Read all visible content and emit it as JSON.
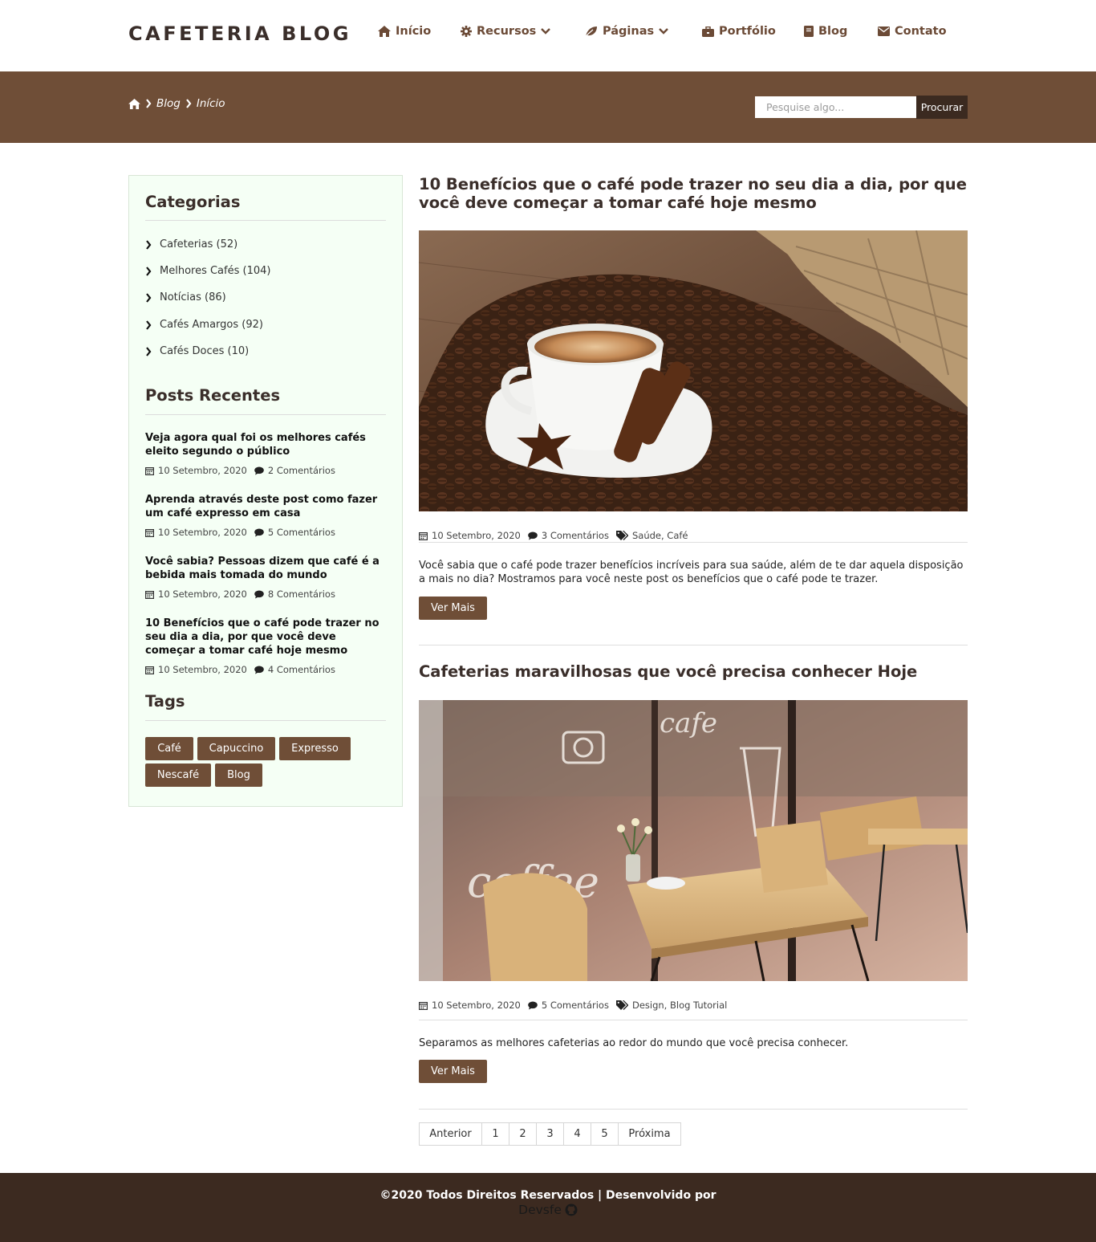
{
  "colors": {
    "brand_brown": "#6f4e37",
    "dark_brown": "#3c2a20",
    "sidebar_bg": "#f5fff5"
  },
  "header": {
    "brand": "CAFETERIA BLOG",
    "nav": [
      {
        "label": "Início",
        "icon": "home-icon"
      },
      {
        "label": "Recursos",
        "icon": "gear-icon",
        "dropdown": true
      },
      {
        "label": "Páginas",
        "icon": "leaf-icon",
        "dropdown": true
      },
      {
        "label": "Portfólio",
        "icon": "briefcase-icon"
      },
      {
        "label": "Blog",
        "icon": "book-icon"
      },
      {
        "label": "Contato",
        "icon": "envelope-icon"
      }
    ]
  },
  "banner": {
    "breadcrumb": [
      "Blog",
      "Início"
    ],
    "search_placeholder": "Pesquise algo...",
    "search_button": "Procurar"
  },
  "sidebar": {
    "categories_title": "Categorias",
    "categories": [
      "Cafeterias (52)",
      "Melhores Cafés (104)",
      "Notícias (86)",
      "Cafés Amargos (92)",
      "Cafés Doces (10)"
    ],
    "recent_title": "Posts Recentes",
    "recent": [
      {
        "title": "Veja agora qual foi os melhores cafés eleito segundo o público",
        "date": "10 Setembro, 2020",
        "comments": "2 Comentários"
      },
      {
        "title": "Aprenda através deste post como fazer um café expresso em casa",
        "date": "10 Setembro, 2020",
        "comments": "5 Comentários"
      },
      {
        "title": "Você sabia? Pessoas dizem que café é a bebida mais tomada do mundo",
        "date": "10 Setembro, 2020",
        "comments": "8 Comentários"
      },
      {
        "title": "10 Benefícios que o café pode trazer no seu dia a dia, por que você deve começar a tomar café hoje mesmo",
        "date": "10 Setembro, 2020",
        "comments": "4 Comentários"
      }
    ],
    "tags_title": "Tags",
    "tags": [
      "Café",
      "Capuccino",
      "Expresso",
      "Nescafé",
      "Blog"
    ]
  },
  "posts": [
    {
      "title": "10 Benefícios que o café pode trazer no seu dia a dia, por que você deve começar a tomar café hoje mesmo",
      "date": "10 Setembro, 2020",
      "comments": "3 Comentários",
      "tags": "Saúde, Café",
      "excerpt": "Você sabia que o café pode trazer benefícios incríveis para sua saúde, além de te dar aquela disposição a mais no dia? Mostramos para você neste post os benefícios que o café pode te trazer.",
      "button": "Ver Mais"
    },
    {
      "title": "Cafeterias maravilhosas que você precisa conhecer Hoje",
      "date": "10 Setembro, 2020",
      "comments": "5 Comentários",
      "tags": "Design, Blog Tutorial",
      "excerpt": "Separamos as melhores cafeterias ao redor do mundo que você precisa conhecer.",
      "button": "Ver Mais"
    }
  ],
  "pagination": [
    "Anterior",
    "1",
    "2",
    "3",
    "4",
    "5",
    "Próxima"
  ],
  "footer": {
    "copyright": "©2020 Todos Direitos Reservados | Desenvolvido por",
    "developer": "Devsfe"
  }
}
